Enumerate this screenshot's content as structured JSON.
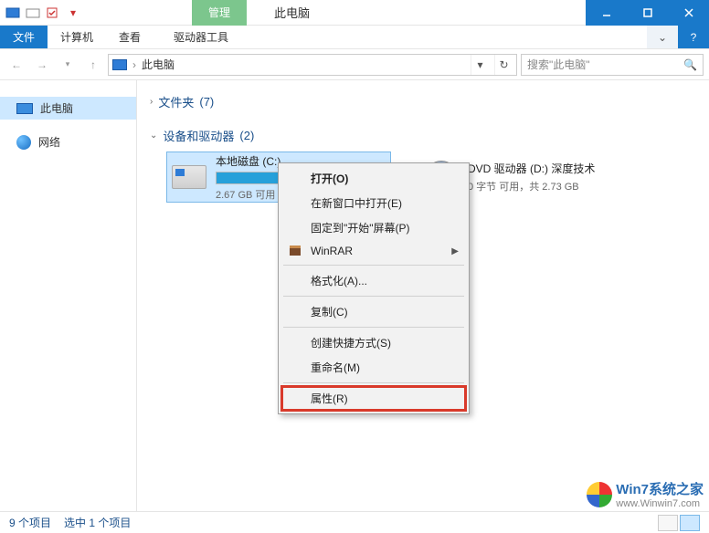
{
  "titlebar": {
    "management_tab": "管理",
    "title": "此电脑"
  },
  "ribbon": {
    "file": "文件",
    "computer": "计算机",
    "view": "查看",
    "drive_tools": "驱动器工具"
  },
  "address": {
    "crumb": "此电脑",
    "search_placeholder": "搜索\"此电脑\""
  },
  "sidebar": {
    "this_pc": "此电脑",
    "network": "网络"
  },
  "groups": {
    "folders": {
      "label": "文件夹",
      "count": "(7)"
    },
    "devices": {
      "label": "设备和驱动器",
      "count": "(2)"
    }
  },
  "drives": [
    {
      "name": "本地磁盘 (C:)",
      "free_text": "2.67 GB 可用",
      "fill_percent": 94,
      "type": "hdd",
      "selected": true
    },
    {
      "name": "DVD 驱动器 (D:) 深度技术",
      "free_text": "0 字节 可用，共 2.73 GB",
      "fill_percent": 0,
      "type": "dvd",
      "selected": false
    }
  ],
  "context_menu": {
    "open": "打开(O)",
    "open_new_window": "在新窗口中打开(E)",
    "pin_start": "固定到\"开始\"屏幕(P)",
    "winrar": "WinRAR",
    "format": "格式化(A)...",
    "copy": "复制(C)",
    "create_shortcut": "创建快捷方式(S)",
    "rename": "重命名(M)",
    "properties": "属性(R)"
  },
  "statusbar": {
    "item_count": "9 个项目",
    "selected": "选中 1 个项目"
  },
  "watermark": {
    "line1": "Win7系统之家",
    "line2": "www.Winwin7.com"
  }
}
